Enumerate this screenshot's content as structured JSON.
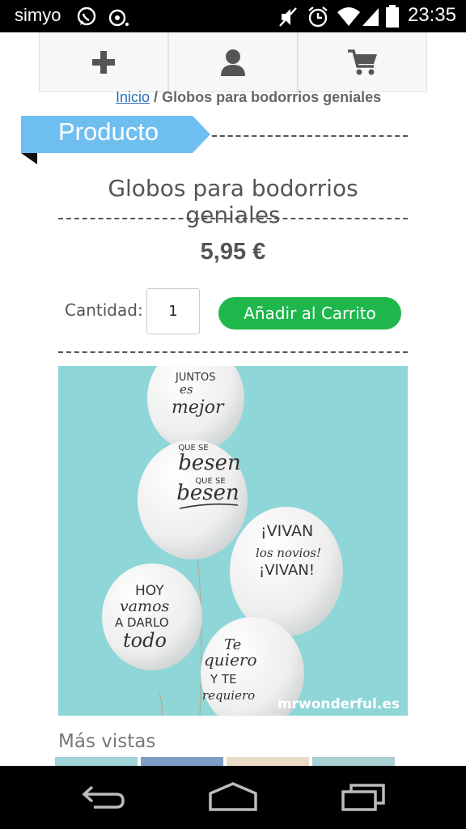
{
  "status_bar": {
    "carrier": "simyo",
    "time": "23:35"
  },
  "breadcrumb": {
    "home": "Inicio",
    "separator": "/",
    "current": "Globos para bodorrios geniales"
  },
  "section_label": "Producto",
  "product": {
    "title": "Globos para bodorrios geniales",
    "price": "5,95 €",
    "quantity_label": "Cantidad:",
    "quantity_value": "1",
    "add_to_cart": "Añadir al Carrito",
    "image_watermark": "mrwonderful.es",
    "balloons": [
      {
        "lines": [
          "JUNTOS",
          "es",
          "mejor"
        ]
      },
      {
        "lines": [
          "QUE SE",
          "besen",
          "QUE SE",
          "besen"
        ]
      },
      {
        "lines": [
          "¡VIVAN",
          "los novios!",
          "¡VIVAN!"
        ]
      },
      {
        "lines": [
          "HOY",
          "vamos",
          "A DARLO",
          "todo"
        ]
      },
      {
        "lines": [
          "Te",
          "quiero",
          "Y TE",
          "requiero"
        ]
      }
    ]
  },
  "more_views": "Más vistas",
  "colors": {
    "accent_blue": "#6fbef0",
    "button_green": "#1fb64c",
    "photo_bg": "#8fd6d8"
  }
}
